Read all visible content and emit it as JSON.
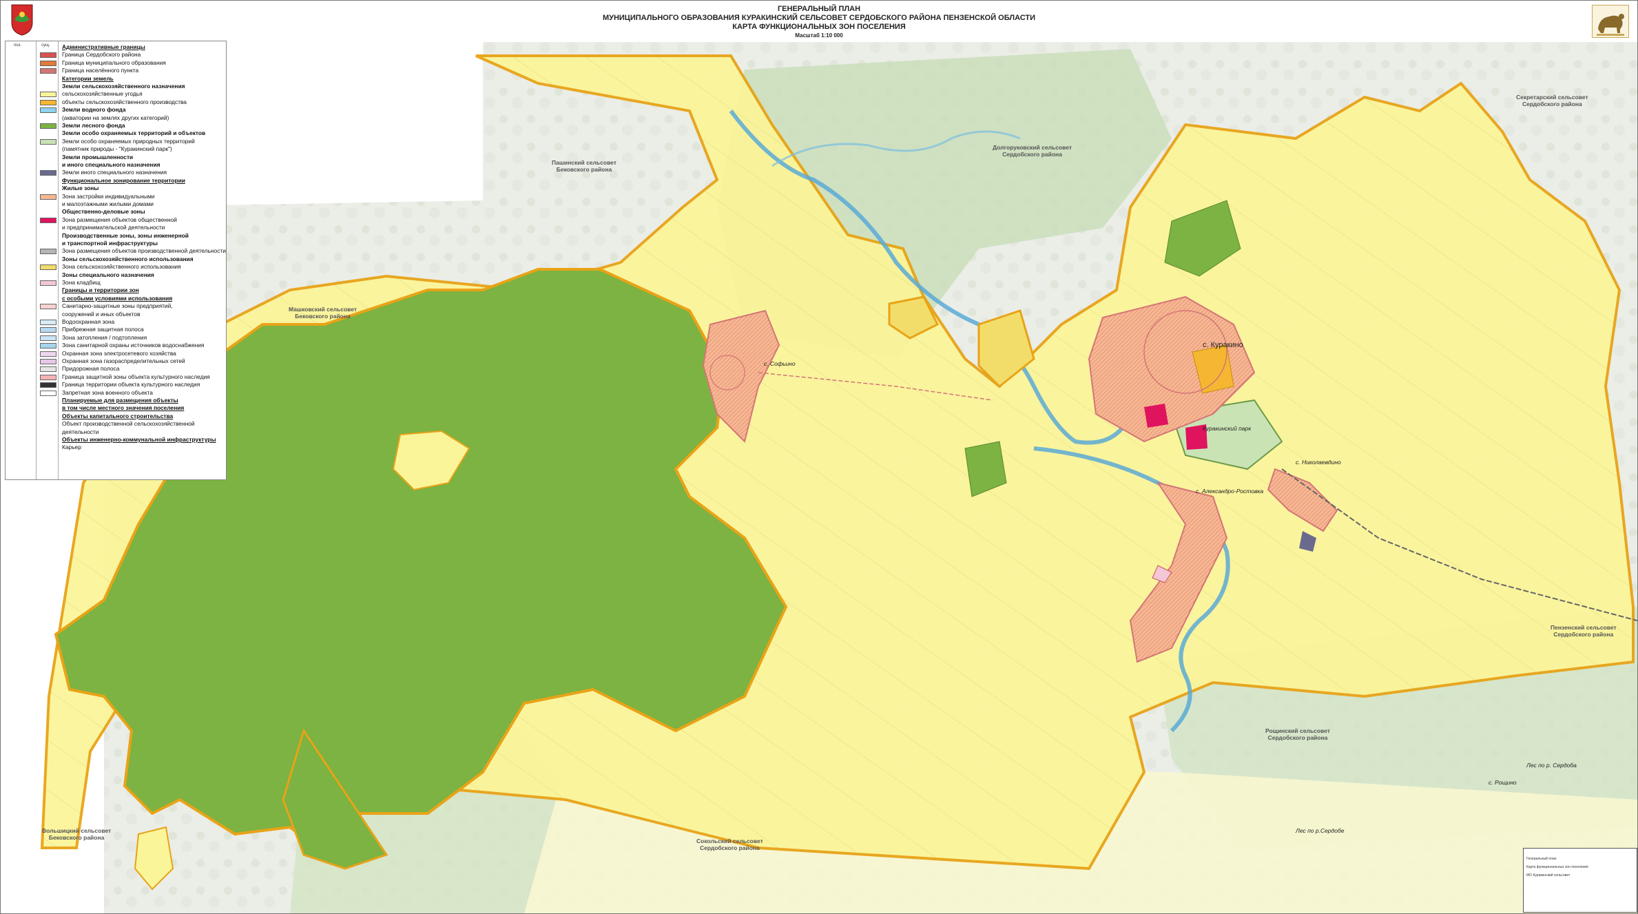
{
  "header": {
    "title_1": "ГЕНЕРАЛЬНЫЙ  ПЛАН",
    "title_2": "МУНИЦИПАЛЬНОГО ОБРАЗОВАНИЯ КУРАКИНСКИЙ СЕЛЬСОВЕТ СЕРДОБСКОГО  РАЙОНА  ПЕНЗЕНСКОЙ  ОБЛАСТИ",
    "title_3": "КАРТА ФУНКЦИОНАЛЬНЫХ ЗОН ПОСЕЛЕНИЯ",
    "scale": "Масштаб 1:10 000"
  },
  "legend": {
    "col1": "поз.",
    "col2": "сущ.",
    "items": [
      {
        "text": "Административные границы",
        "style": "u",
        "swatch": ""
      },
      {
        "text": "Граница Сердобского района",
        "style": "",
        "swatch": "#d9534f"
      },
      {
        "text": "Граница муниципального образования",
        "style": "",
        "swatch": "#e07b39"
      },
      {
        "text": "Граница населённого пункта",
        "style": "",
        "swatch": "#d47575"
      },
      {
        "text": "Категории земель",
        "style": "u",
        "swatch": ""
      },
      {
        "text": "Земли сельскохозяйственного назначения",
        "style": "b",
        "swatch": ""
      },
      {
        "text": "сельскохозяйственные угодья",
        "style": "",
        "swatch": "#fbf59a"
      },
      {
        "text": "объекты сельскохозяйственного производства",
        "style": "",
        "swatch": "#f5b731"
      },
      {
        "text": "Земли водного фонда",
        "style": "b",
        "swatch": "#8fd3f0"
      },
      {
        "text": "(акватории на землях других категорий)",
        "style": "",
        "swatch": ""
      },
      {
        "text": "Земли лесного фонда",
        "style": "b",
        "swatch": "#7cb342"
      },
      {
        "text": "Земли особо охраняемых территорий и объектов",
        "style": "b",
        "swatch": ""
      },
      {
        "text": "Земли особо охраняемых природных территорий",
        "style": "",
        "swatch": "#c9e3b4"
      },
      {
        "text": "(памятник природы - \"Куракинский парк\")",
        "style": "",
        "swatch": ""
      },
      {
        "text": "Земли промышленности",
        "style": "b",
        "swatch": ""
      },
      {
        "text": "и иного специального назначения",
        "style": "b",
        "swatch": ""
      },
      {
        "text": "Земли иного специального назначения",
        "style": "",
        "swatch": "#6a6a8e"
      },
      {
        "text": "Функциональное зонирование территории",
        "style": "u",
        "swatch": ""
      },
      {
        "text": "Жилые зоны",
        "style": "b",
        "swatch": ""
      },
      {
        "text": "Зона застройки индивидуальными",
        "style": "",
        "swatch": "#f6b891"
      },
      {
        "text": "и малоэтажными жилыми домами",
        "style": "",
        "swatch": ""
      },
      {
        "text": "Общественно-деловые зоны",
        "style": "b",
        "swatch": ""
      },
      {
        "text": "Зона размещения объектов общественной",
        "style": "",
        "swatch": "#e0135f"
      },
      {
        "text": "и предпринимательской деятельности",
        "style": "",
        "swatch": ""
      },
      {
        "text": "Производственные зоны, зоны инженерной",
        "style": "b",
        "swatch": ""
      },
      {
        "text": "и транспортной инфраструктуры",
        "style": "b",
        "swatch": ""
      },
      {
        "text": "Зона размещения объектов производственной деятельности",
        "style": "",
        "swatch": "#b5b5b5"
      },
      {
        "text": "Зоны сельскохозяйственного использования",
        "style": "b",
        "swatch": ""
      },
      {
        "text": "Зона сельскохозяйственного использования",
        "style": "",
        "swatch": "#f3dd6a"
      },
      {
        "text": "Зоны специального назначения",
        "style": "b",
        "swatch": ""
      },
      {
        "text": "Зона кладбищ",
        "style": "",
        "swatch": "#f3c6d8"
      },
      {
        "text": "Границы и территории зон",
        "style": "u",
        "swatch": ""
      },
      {
        "text": "с особыми условиями использования",
        "style": "u",
        "swatch": ""
      },
      {
        "text": "Санитарно-защитные зоны предприятий,",
        "style": "",
        "swatch": "#f9d0d0"
      },
      {
        "text": "сооружений и иных объектов",
        "style": "",
        "swatch": ""
      },
      {
        "text": "Водоохранная зона",
        "style": "",
        "swatch": "#d7ebf7"
      },
      {
        "text": "Прибрежная защитная полоса",
        "style": "",
        "swatch": "#b6d8f0"
      },
      {
        "text": "Зона затопления / подтопления",
        "style": "",
        "swatch": "#c9e4f5"
      },
      {
        "text": "Зона санитарной охраны источников водоснабжения",
        "style": "",
        "swatch": "#a7d4ec"
      },
      {
        "text": "Охранная зона электросетевого хозяйства",
        "style": "",
        "swatch": "#f0d7f0"
      },
      {
        "text": "Охранная зона газораспределительных сетей",
        "style": "",
        "swatch": "#e7c7e7"
      },
      {
        "text": "Придорожная полоса",
        "style": "",
        "swatch": "#e6e6e6"
      },
      {
        "text": "Граница защитной зоны объекта культурного наследия",
        "style": "",
        "swatch": "#f4b3b3"
      },
      {
        "text": "Граница территории объекта культурного наследия",
        "style": "",
        "swatch": "#333333"
      },
      {
        "text": "Запретная зона военного объекта",
        "style": "",
        "swatch": "#ffffff"
      },
      {
        "text": "Планируемые для размещения объекты",
        "style": "u",
        "swatch": ""
      },
      {
        "text": "в том числе местного значения поселения",
        "style": "u",
        "swatch": ""
      },
      {
        "text": "Объекты капитального строительства",
        "style": "u",
        "swatch": ""
      },
      {
        "text": "Объект производственной сельскохозяйственной",
        "style": "",
        "swatch": ""
      },
      {
        "text": "деятельности",
        "style": "",
        "swatch": ""
      },
      {
        "text": "Объекты инженерно-коммунальной инфраструктуры",
        "style": "u",
        "swatch": ""
      },
      {
        "text": "Карьер",
        "style": "",
        "swatch": ""
      }
    ]
  },
  "map_labels": {
    "penzin": [
      "Пашинский сельсовет",
      "Бековского района"
    ],
    "dolgorukov": [
      "Долгоруковский сельсовет",
      "Сердобского района"
    ],
    "sekretar": [
      "Секретарский сельсовет",
      "Сердобского района"
    ],
    "mashkov": [
      "Машковский сельсовет",
      "Бековского района"
    ],
    "penzen": [
      "Пензенский сельсовет",
      "Сердобского района"
    ],
    "roshin": [
      "Рощинский сельсовет",
      "Сердобского района"
    ],
    "volyn": [
      "Вольшицкий сельсовет",
      "Бековского района"
    ],
    "sokol": [
      "Сокольский сельсовет",
      "Сердобского района"
    ]
  },
  "villages": {
    "kurakino": "с. Куракино",
    "sofino": "с. Софьино",
    "nikolaevka": "с. Николаевдино",
    "aleksandro": "с. Александро-Ростовка",
    "park": "Куракинский парк",
    "les_serdoba": "Лес по р. Сердоба",
    "les_serdobe": "Лес по р.Сердобе",
    "roshino": "с. Рощино"
  },
  "colors": {
    "agri": "#fbf59a",
    "agri_zone": "#f3dd6a",
    "forest": "#7cb342",
    "boundary": "#e8a317",
    "residential": "#f6b891",
    "public": "#e0135f",
    "water": "#5aa9d6",
    "protected": "#c9e3b4"
  },
  "stamp": {
    "line1": "Генеральный план",
    "line2": "Карта функциональных зон поселения",
    "line3": "МО Куракинский сельсовет"
  }
}
